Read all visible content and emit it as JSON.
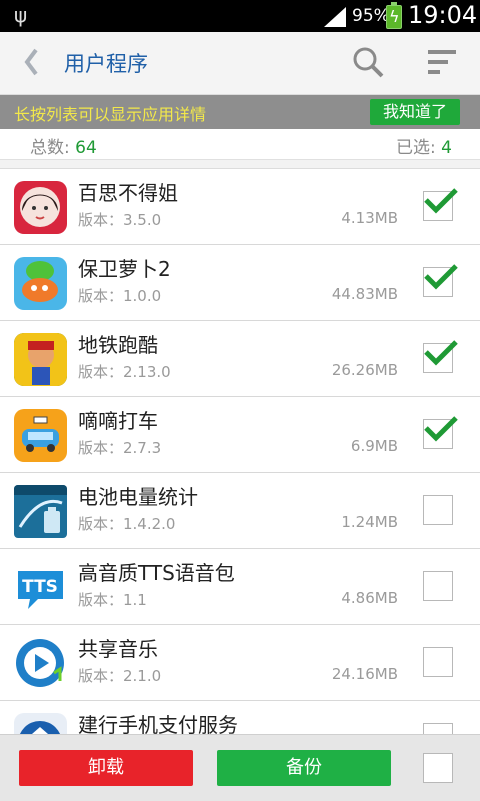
{
  "status_bar": {
    "battery": "95%",
    "time": "19:04"
  },
  "header": {
    "title": "用户程序"
  },
  "tip": {
    "text": "长按列表可以显示应用详情",
    "button": "我知道了"
  },
  "summary": {
    "total_label": "总数:",
    "total_value": "64",
    "selected_label": "已选:",
    "selected_value": "4"
  },
  "apps": [
    {
      "name": "百思不得姐",
      "version": "版本：3.5.0",
      "size": "4.13MB",
      "checked": true,
      "icon": "baisi-icon"
    },
    {
      "name": "保卫萝卜2",
      "version": "版本：1.0.0",
      "size": "44.83MB",
      "checked": true,
      "icon": "carrot-icon"
    },
    {
      "name": "地铁跑酷",
      "version": "版本：2.13.0",
      "size": "26.26MB",
      "checked": true,
      "icon": "subway-surfers-icon"
    },
    {
      "name": "嘀嘀打车",
      "version": "版本：2.7.3",
      "size": "6.9MB",
      "checked": true,
      "icon": "taxi-icon"
    },
    {
      "name": "电池电量统计",
      "version": "版本：1.4.2.0",
      "size": "1.24MB",
      "checked": false,
      "icon": "battery-stats-icon"
    },
    {
      "name": "高音质TTS语音包",
      "version": "版本：1.1",
      "size": "4.86MB",
      "checked": false,
      "icon": "tts-icon"
    },
    {
      "name": "共享音乐",
      "version": "版本：2.1.0",
      "size": "24.16MB",
      "checked": false,
      "icon": "music-share-icon"
    },
    {
      "name": "建行手机支付服务",
      "version": "",
      "size": "",
      "checked": false,
      "icon": "ccb-icon"
    }
  ],
  "bottom": {
    "uninstall": "卸载",
    "backup": "备份"
  },
  "colors": {
    "accent_green": "#1fb045",
    "danger_red": "#e8232a",
    "title_blue": "#2060a8",
    "tip_yellow": "#f2e84a"
  }
}
